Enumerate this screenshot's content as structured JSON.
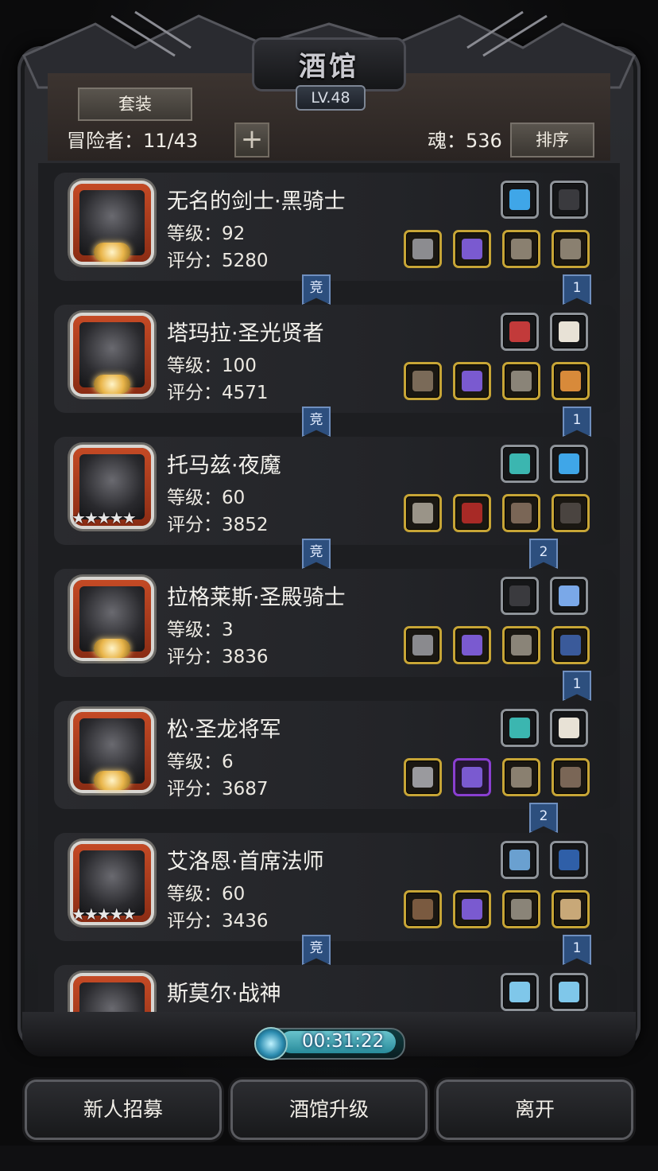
{
  "header": {
    "title": "酒馆",
    "level": "LV.48",
    "suit_button": "套装",
    "adventurers_text": "冒险者：11/43",
    "plus_label": "+",
    "soul_text": "魂：536",
    "sort_button": "排序"
  },
  "heroes": [
    {
      "name": "无名的剑士·黑骑士",
      "level": "等级：92",
      "score": "评分：5280",
      "badge": "moon",
      "acc": [
        "blue-crystal-icon",
        "black-glove-icon"
      ],
      "equip": [
        "pickaxe-icon",
        "purple-armor-icon",
        "helmet-icon",
        "helmet-icon"
      ],
      "link_left": "竞",
      "link_right": "1"
    },
    {
      "name": "塔玛拉·圣光贤者",
      "level": "等级：100",
      "score": "评分：4571",
      "badge": "moon",
      "acc": [
        "red-charm-icon",
        "white-fur-icon"
      ],
      "equip": [
        "hammer-icon",
        "purple-armor-icon",
        "gauntlet-icon",
        "ring-icon"
      ],
      "link_left": "竞",
      "link_right": "1"
    },
    {
      "name": "托马兹·夜魔",
      "level": "等级：60",
      "score": "评分：3852",
      "badge": "stars",
      "stars": "★★★★★",
      "acc": [
        "teal-gem-icon",
        "blue-crystal-icon"
      ],
      "equip": [
        "spear-icon",
        "red-hood-icon",
        "boots-icon",
        "cloak-icon"
      ],
      "link_left": "竞",
      "link_right": "2"
    },
    {
      "name": "拉格莱斯·圣殿骑士",
      "level": "等级：3",
      "score": "评分：3836",
      "badge": "moon",
      "acc": [
        "black-glove-icon",
        "lightning-rune-icon"
      ],
      "equip": [
        "axe-icon",
        "purple-armor-icon",
        "gauntlet-icon",
        "red-eye-helm-icon"
      ],
      "link_left": "",
      "link_right": "1"
    },
    {
      "name": "松·圣龙将军",
      "level": "等级：6",
      "score": "评分：3687",
      "badge": "moon",
      "acc": [
        "teal-gem-icon",
        "white-fur-icon"
      ],
      "equip": [
        "sword-icon",
        "purple-armor-icon",
        "helmet-icon",
        "boots-icon"
      ],
      "link_left": "",
      "link_right": "2"
    },
    {
      "name": "艾洛恩·首席法师",
      "level": "等级：60",
      "score": "评分：3436",
      "badge": "stars",
      "stars": "★★★★★",
      "acc": [
        "amulet-icon",
        "bow-icon"
      ],
      "equip": [
        "staff-icon",
        "purple-armor-icon",
        "gauntlet-icon",
        "necklace-icon"
      ],
      "link_left": "竞",
      "link_right": "1"
    },
    {
      "name": "斯莫尔·战神",
      "level": "",
      "score": "",
      "badge": "",
      "acc": [
        "blue-scroll-icon",
        "blue-scroll-icon"
      ],
      "equip": [],
      "link_left": "",
      "link_right": ""
    }
  ],
  "timer": "00:31:22",
  "buttons": {
    "recruit": "新人招募",
    "upgrade": "酒馆升级",
    "leave": "离开"
  },
  "colors": {
    "portrait_frame": "#c44a25",
    "equip_border": "#c7a536",
    "rare_border": "#8a3fd1",
    "link_blue": "#2d4f7e"
  }
}
